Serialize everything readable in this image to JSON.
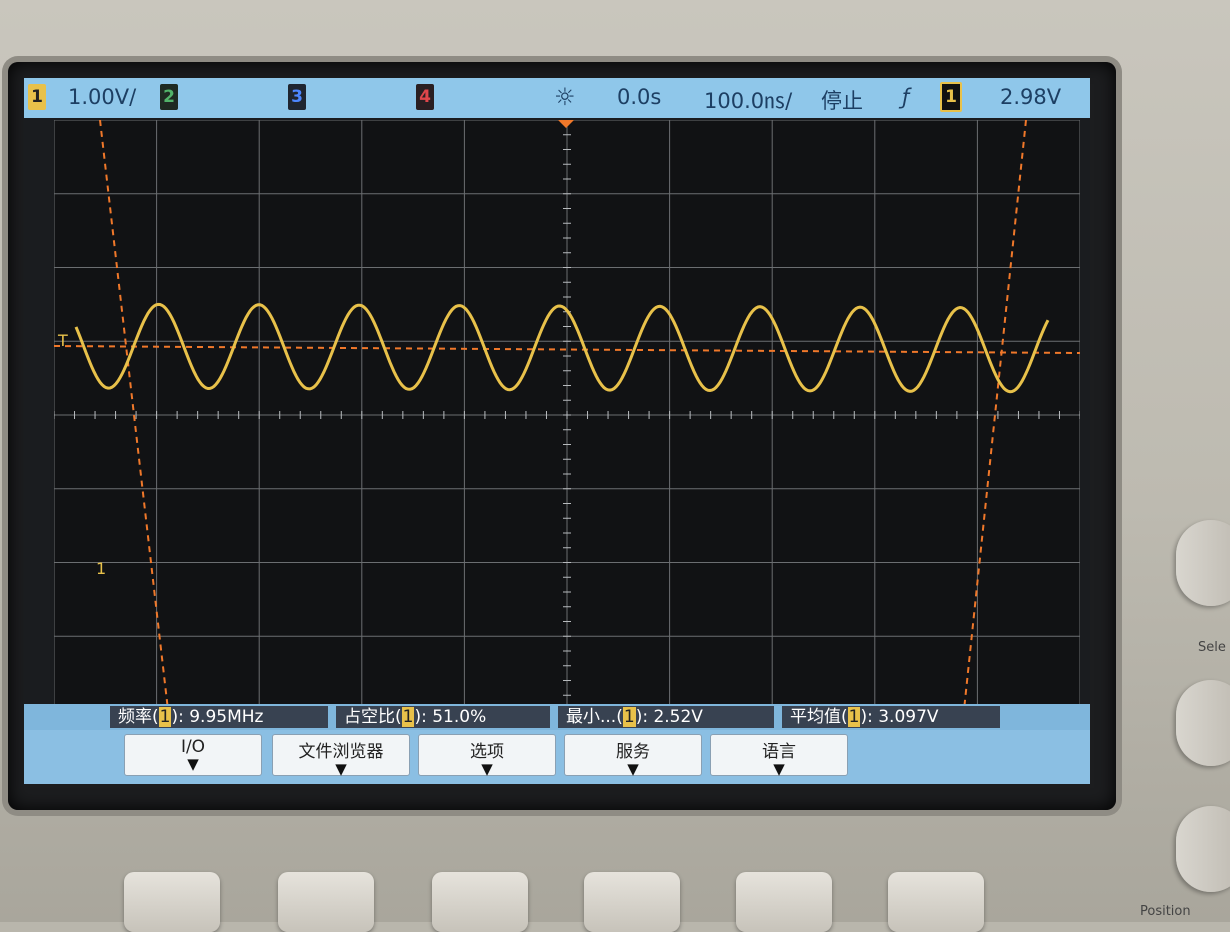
{
  "status_bar": {
    "ch1_badge": "1",
    "ch1_scale": "1.00V/",
    "ch2_badge": "2",
    "ch3_badge": "3",
    "ch4_badge": "4",
    "time_delay": "0.0s",
    "time_scale": "100.0㎱/",
    "run_state": "停止",
    "trigger_slope_symbol": "ƒ",
    "trigger_source_badge": "1",
    "trigger_level": "2.98V",
    "colors": {
      "ch1": "#e8c14a",
      "ch2": "#52b36a",
      "ch3": "#2b5fd1",
      "ch4": "#e0464b"
    }
  },
  "markers": {
    "trigger_marker": "T",
    "ch1_ground_marker": "1"
  },
  "measurements": [
    {
      "name": "频率",
      "source": "1",
      "value": "9.95MHz"
    },
    {
      "name": "占空比",
      "source": "1",
      "value": "51.0%"
    },
    {
      "name": "最小...",
      "source": "1",
      "value": "2.52V"
    },
    {
      "name": "平均值",
      "source": "1",
      "value": "3.097V"
    }
  ],
  "softkeys": [
    {
      "label": "I/O",
      "arrow": "▼"
    },
    {
      "label": "文件浏览器",
      "arrow": "▼"
    },
    {
      "label": "选项",
      "arrow": "▼"
    },
    {
      "label": "服务",
      "arrow": "▼"
    },
    {
      "label": "语言",
      "arrow": "▼"
    }
  ],
  "panel_labels": {
    "select": "Sele",
    "position": "Position"
  },
  "waveform": {
    "channel": "1",
    "shape": "sine",
    "frequency_mhz": 9.95,
    "duty_cycle_percent": 51.0,
    "min_v": 2.52,
    "mean_v": 3.097,
    "cycles_visible": 10,
    "color": "#e8c14a"
  }
}
